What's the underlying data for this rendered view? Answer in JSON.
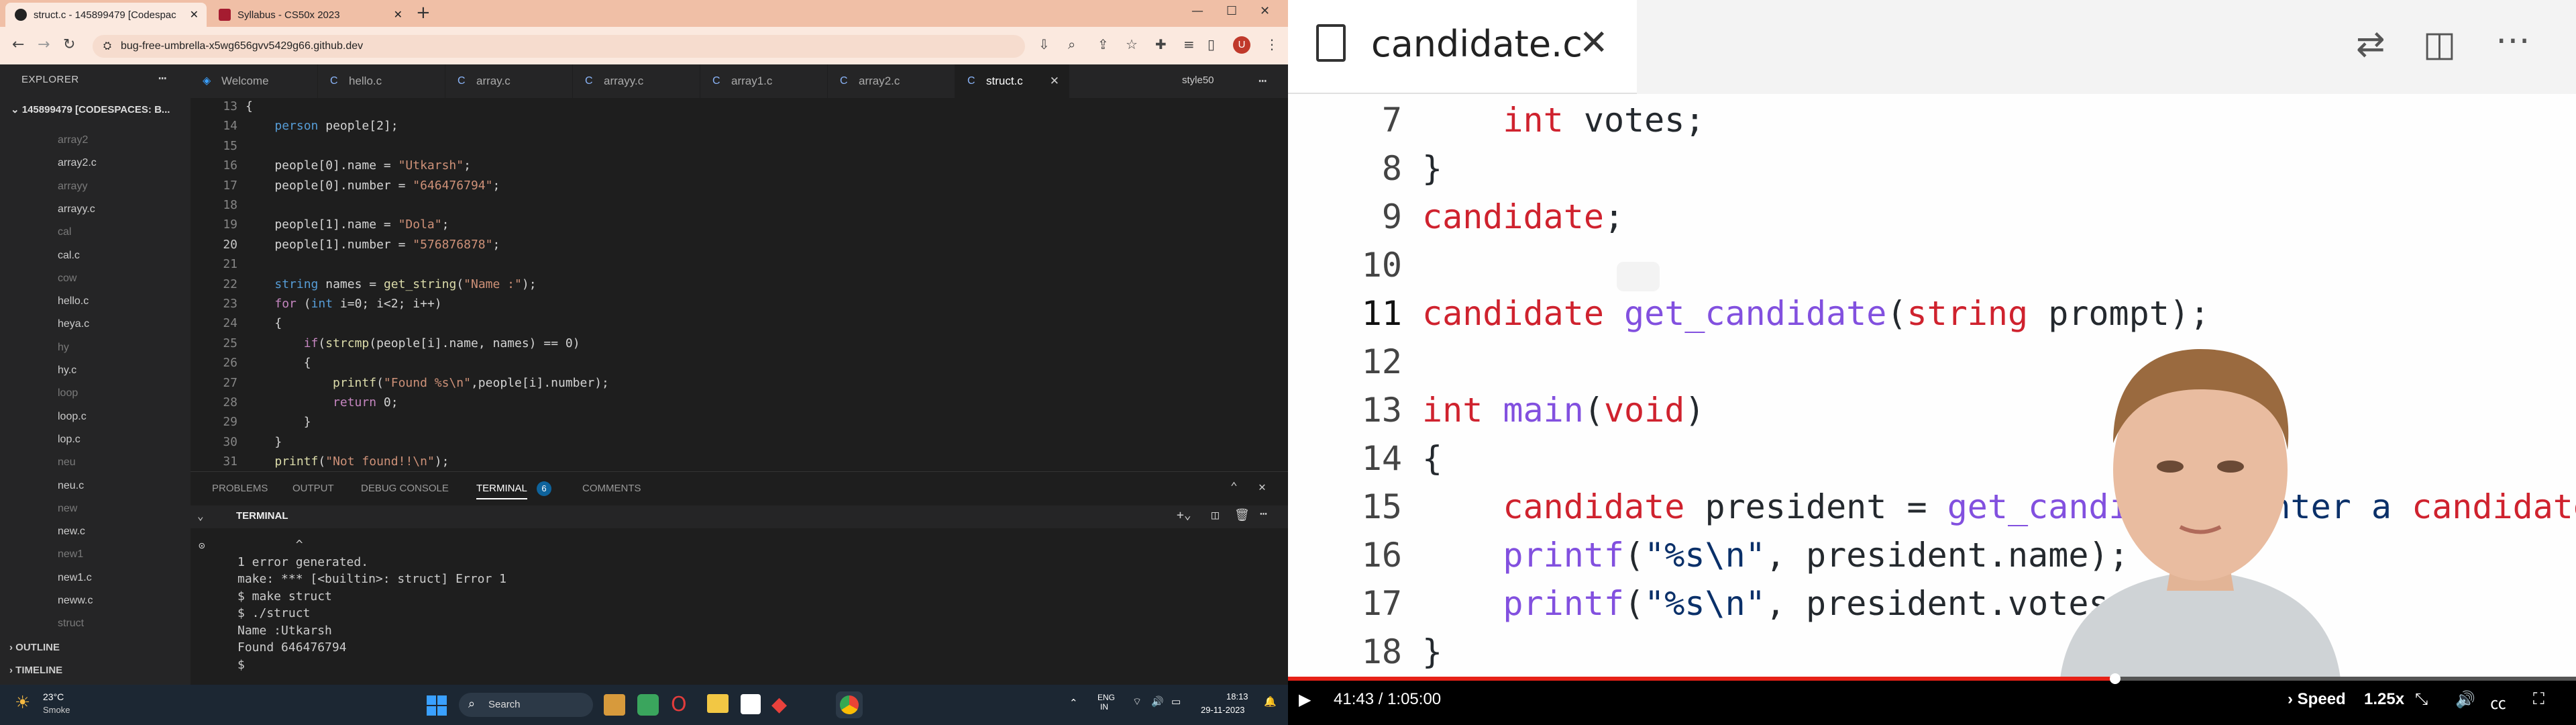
{
  "browser": {
    "tabs": [
      {
        "title": "struct.c - 145899479 [Codespac",
        "active": true
      },
      {
        "title": "Syllabus - CS50x 2023",
        "active": false
      }
    ],
    "url": "bug-free-umbrella-x5wg656gvv5429g66.github.dev",
    "profile_initial": "U"
  },
  "vscode": {
    "explorer_title": "EXPLORER",
    "project": "145899479 [CODESPACES: B...",
    "files": [
      {
        "name": "array2",
        "dim": true
      },
      {
        "name": "array2.c",
        "dim": false
      },
      {
        "name": "arrayy",
        "dim": true
      },
      {
        "name": "arrayy.c",
        "dim": false
      },
      {
        "name": "cal",
        "dim": true
      },
      {
        "name": "cal.c",
        "dim": false
      },
      {
        "name": "cow",
        "dim": true
      },
      {
        "name": "hello.c",
        "dim": false
      },
      {
        "name": "heya.c",
        "dim": false
      },
      {
        "name": "hy",
        "dim": true
      },
      {
        "name": "hy.c",
        "dim": false
      },
      {
        "name": "loop",
        "dim": true
      },
      {
        "name": "loop.c",
        "dim": false
      },
      {
        "name": "lop.c",
        "dim": false
      },
      {
        "name": "neu",
        "dim": true
      },
      {
        "name": "neu.c",
        "dim": false
      },
      {
        "name": "new",
        "dim": true
      },
      {
        "name": "new.c",
        "dim": false
      },
      {
        "name": "new1",
        "dim": true
      },
      {
        "name": "new1.c",
        "dim": false
      },
      {
        "name": "neww.c",
        "dim": false
      },
      {
        "name": "struct",
        "dim": true
      }
    ],
    "outline": "OUTLINE",
    "timeline": "TIMELINE",
    "editor_tabs": [
      {
        "label": "Welcome",
        "active": false
      },
      {
        "label": "hello.c",
        "active": false
      },
      {
        "label": "array.c",
        "active": false
      },
      {
        "label": "arrayy.c",
        "active": false
      },
      {
        "label": "array1.c",
        "active": false
      },
      {
        "label": "array2.c",
        "active": false
      },
      {
        "label": "struct.c",
        "active": true
      }
    ],
    "style_button": "style50",
    "code_lines": [
      {
        "n": "13",
        "t": "{"
      },
      {
        "n": "14",
        "t": "    person people[2];"
      },
      {
        "n": "15",
        "t": ""
      },
      {
        "n": "16",
        "t": "    people[0].name = \"Utkarsh\";"
      },
      {
        "n": "17",
        "t": "    people[0].number = \"646476794\";"
      },
      {
        "n": "18",
        "t": ""
      },
      {
        "n": "19",
        "t": "    people[1].name = \"Dola\";"
      },
      {
        "n": "20",
        "t": "    people[1].number = \"576876878\";"
      },
      {
        "n": "21",
        "t": ""
      },
      {
        "n": "22",
        "t": "    string names = get_string(\"Name :\");"
      },
      {
        "n": "23",
        "t": "    for (int i=0; i<2; i++)"
      },
      {
        "n": "24",
        "t": "    {"
      },
      {
        "n": "25",
        "t": "        if(strcmp(people[i].name, names) == 0)"
      },
      {
        "n": "26",
        "t": "        {"
      },
      {
        "n": "27",
        "t": "            printf(\"Found %s\\n\",people[i].number);"
      },
      {
        "n": "28",
        "t": "            return 0;"
      },
      {
        "n": "29",
        "t": "        }"
      },
      {
        "n": "30",
        "t": "    }"
      },
      {
        "n": "31",
        "t": "    printf(\"Not found!!\\n\");"
      }
    ],
    "current_line": "20",
    "panel_tabs": [
      "PROBLEMS",
      "OUTPUT",
      "DEBUG CONSOLE",
      "TERMINAL",
      "COMMENTS"
    ],
    "terminal_badge": "6",
    "terminal_label": "TERMINAL",
    "terminal_lines": [
      "        ^",
      "1 error generated.",
      "make: *** [<builtin>: struct] Error 1",
      "$ make struct",
      "$ ./struct",
      "Name :Utkarsh",
      "Found 646476794",
      "$ "
    ]
  },
  "taskbar": {
    "weather_temp": "23°C",
    "weather_desc": "Smoke",
    "search": "Search",
    "lang1": "ENG",
    "lang2": "IN",
    "time": "18:13",
    "date": "29-11-2023"
  },
  "video": {
    "file_title": "candidate.c",
    "code": [
      {
        "n": "7",
        "t": "    int votes;"
      },
      {
        "n": "8",
        "t": "}"
      },
      {
        "n": "9",
        "t": "candidate;"
      },
      {
        "n": "10",
        "t": ""
      },
      {
        "n": "11",
        "t": "candidate get_candidate(string prompt);"
      },
      {
        "n": "12",
        "t": ""
      },
      {
        "n": "13",
        "t": "int main(void)"
      },
      {
        "n": "14",
        "t": "{"
      },
      {
        "n": "15",
        "t": "    candidate president = get_candidate(\"Enter a candidate: "
      },
      {
        "n": "16",
        "t": "    printf(\"%s\\n\", president.name);"
      },
      {
        "n": "17",
        "t": "    printf(\"%s\\n\", president.votes"
      },
      {
        "n": "18",
        "t": "}"
      }
    ],
    "current_line": "11",
    "time": "41:43 / 1:05:00",
    "progress": 0.642,
    "speed_label": "Speed",
    "speed_value": "1.25x"
  }
}
